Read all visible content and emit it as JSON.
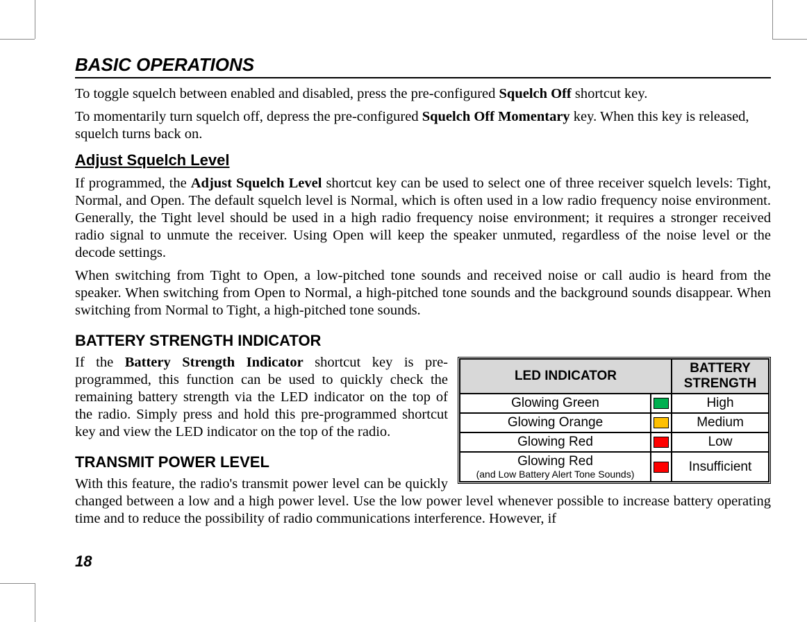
{
  "section_title": "BASIC OPERATIONS",
  "para1_pre": "To toggle squelch between enabled and disabled, press the pre-configured ",
  "para1_bold": "Squelch Off",
  "para1_post": " shortcut key.",
  "para2_pre": "To momentarily turn squelch off, depress the pre-configured ",
  "para2_bold": "Squelch Off Momentary",
  "para2_post": " key. When this key is released, squelch turns back on.",
  "adjust_heading": "Adjust Squelch Level",
  "para3_pre": "If programmed, the ",
  "para3_bold": "Adjust Squelch Level",
  "para3_post": " shortcut key can be used to select one of three receiver squelch levels: Tight, Normal, and Open. The default squelch level is Normal, which is often used in a low radio frequency noise environment. Generally, the Tight level should be used in a high radio frequency noise environment; it requires a stronger received radio signal to unmute the receiver. Using Open will keep the speaker unmuted, regardless of the noise level or the decode settings.",
  "para4": "When switching from Tight to Open, a low-pitched tone sounds and received noise or call audio is heard from the speaker. When switching from Open to Normal, a high-pitched tone sounds and the background sounds disappear. When switching from Normal to Tight, a high-pitched tone sounds.",
  "battery_heading": "BATTERY STRENGTH INDICATOR",
  "para5_pre": "If the ",
  "para5_bold": "Battery Strength Indicator",
  "para5_post": " shortcut key is pre-programmed, this function can be used to quickly check the remaining battery strength via the LED indicator on the top of the radio. Simply press and hold this pre-programmed shortcut key and view the LED indicator on the top of the radio.",
  "tx_heading": "TRANSMIT POWER LEVEL",
  "para6": "With this feature, the radio's transmit power level can be quickly changed between a low and a high power level. Use the low power level whenever possible to increase battery operating time and to reduce the possibility of radio communications interference. However, if",
  "page_number": "18",
  "chart_data": {
    "type": "table",
    "title": "Battery LED Indicator",
    "headers": [
      "LED INDICATOR",
      "BATTERY STRENGTH"
    ],
    "rows": [
      {
        "led": "Glowing Green",
        "color": "#00b050",
        "strength": "High"
      },
      {
        "led": "Glowing Orange",
        "color": "#ffc000",
        "strength": "Medium"
      },
      {
        "led": "Glowing Red",
        "color": "#ff0000",
        "strength": "Low"
      },
      {
        "led": "Glowing Red",
        "note": "(and Low Battery Alert Tone Sounds)",
        "color": "#ff0000",
        "strength": "Insufficient"
      }
    ]
  },
  "table": {
    "h_led": "LED INDICATOR",
    "h_str": "BATTERY STRENGTH",
    "r1_led": "Glowing Green",
    "r1_str": "High",
    "r2_led": "Glowing Orange",
    "r2_str": "Medium",
    "r3_led": "Glowing Red",
    "r3_str": "Low",
    "r4_led": "Glowing Red",
    "r4_note": "(and Low Battery Alert Tone Sounds)",
    "r4_str": "Insufficient"
  }
}
